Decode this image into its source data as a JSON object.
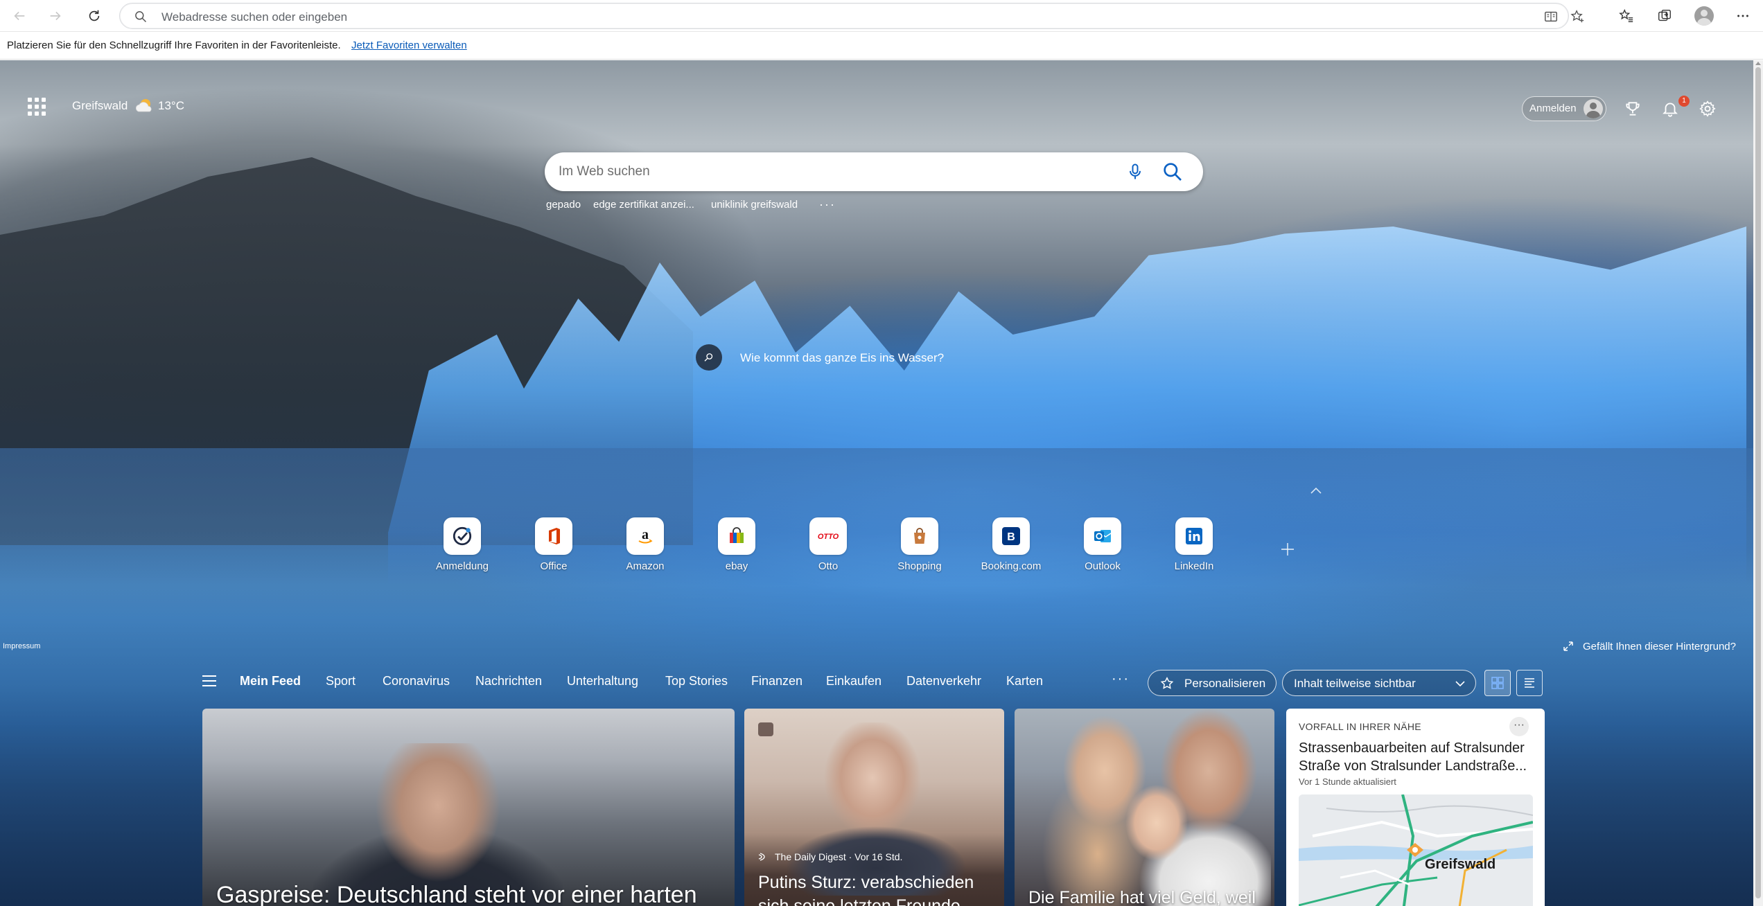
{
  "browser": {
    "address_placeholder": "Webadresse suchen oder eingeben"
  },
  "favorites_bar": {
    "message": "Platzieren Sie für den Schnellzugriff Ihre Favoriten in der Favoritenleiste.",
    "link": "Jetzt Favoriten verwalten"
  },
  "weather": {
    "city": "Greifswald",
    "temperature": "13°C",
    "icon": "partly-sunny-icon"
  },
  "header": {
    "signin_label": "Anmelden",
    "notification_count": "1"
  },
  "search": {
    "placeholder": "Im Web suchen",
    "suggestions": [
      "gepado",
      "edge zertifikat anzei...",
      "uniklinik greifswald"
    ],
    "more": "···"
  },
  "background": {
    "question": "Wie kommt das ganze Eis ins Wasser?",
    "like_prompt": "Gefällt Ihnen dieser Hintergrund?",
    "impressum": "Impressum"
  },
  "tiles": [
    {
      "label": "Anmeldung",
      "icon": "check-circle-icon",
      "color": "#1f2a44"
    },
    {
      "label": "Office",
      "icon": "office-icon",
      "color": "#d83b01"
    },
    {
      "label": "Amazon",
      "icon": "amazon-icon",
      "color": "#111111"
    },
    {
      "label": "ebay",
      "icon": "shopping-bag-icon",
      "color": "#0064d2"
    },
    {
      "label": "Otto",
      "icon": "otto-icon",
      "color": "#e30613"
    },
    {
      "label": "Shopping",
      "icon": "shopping-icon",
      "color": "#c87a3d"
    },
    {
      "label": "Booking.com",
      "icon": "booking-icon",
      "color": "#003580"
    },
    {
      "label": "Outlook",
      "icon": "outlook-icon",
      "color": "#0072c6"
    },
    {
      "label": "LinkedIn",
      "icon": "linkedin-icon",
      "color": "#0a66c2"
    }
  ],
  "feed_nav": {
    "tabs": [
      "Mein Feed",
      "Sport",
      "Coronavirus",
      "Nachrichten",
      "Unterhaltung",
      "Top Stories",
      "Finanzen",
      "Einkaufen",
      "Datenverkehr",
      "Karten"
    ],
    "more": "···",
    "personalize": "Personalisieren",
    "visibility": "Inhalt teilweise sichtbar"
  },
  "cards": {
    "main": {
      "title": "Gaspreise: Deutschland steht vor einer harten"
    },
    "putin": {
      "source": "The Daily Digest · Vor 16 Std.",
      "title": "Putins Sturz: verabschieden sich seine letzten Freunde"
    },
    "family": {
      "title": "Die Familie hat viel Geld, weil"
    },
    "local": {
      "label": "VORFALL IN IHRER NÄHE",
      "title": "Strassenbauarbeiten auf Stralsunder Straße von Stralsunder Landstraße...",
      "time": "Vor 1 Stunde aktualisiert",
      "map_city": "Greifswald",
      "more": "···"
    }
  }
}
